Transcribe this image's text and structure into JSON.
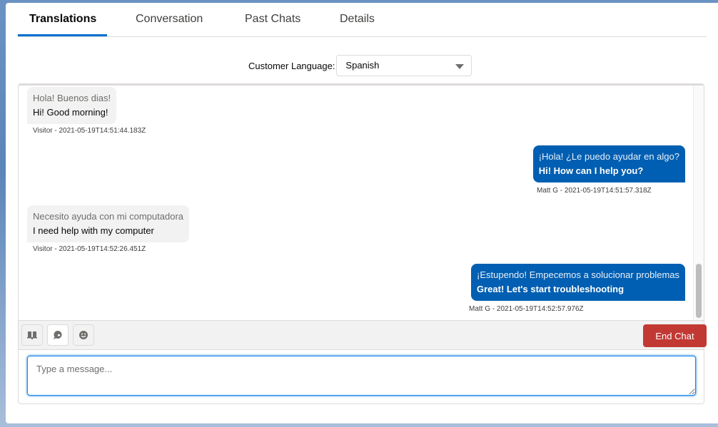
{
  "tabs": [
    {
      "label": "Translations",
      "active": true
    },
    {
      "label": "Conversation",
      "active": false
    },
    {
      "label": "Past Chats",
      "active": false
    },
    {
      "label": "Details",
      "active": false
    }
  ],
  "language": {
    "label": "Customer Language:",
    "selected": "Spanish"
  },
  "messages": [
    {
      "sender": "visitor",
      "original": "Hola! Buenos dias!",
      "translation": "Hi! Good morning!",
      "meta": "Visitor - 2021-05-19T14:51:44.183Z"
    },
    {
      "sender": "agent",
      "original": "¡Hola! ¿Le puedo ayudar en algo?",
      "translation": "Hi! How can I help you?",
      "meta": "Matt G - 2021-05-19T14:51:57.318Z"
    },
    {
      "sender": "visitor",
      "original": "Necesito ayuda con mi computadora",
      "translation": "I need help with my computer",
      "meta": "Visitor - 2021-05-19T14:52:26.451Z"
    },
    {
      "sender": "agent",
      "original": "¡Estupendo! Empecemos a solucionar problemas",
      "translation": "Great! Let's start troubleshooting",
      "meta": "Matt G - 2021-05-19T14:52:57.976Z"
    }
  ],
  "toolbar": {
    "icons": [
      "knowledge-book-icon",
      "chat-bubble-icon",
      "emoji-icon"
    ],
    "end_chat_label": "End Chat",
    "end_chat_color": "#c23934"
  },
  "composer": {
    "placeholder": "Type a message...",
    "value": ""
  },
  "colors": {
    "accent": "#0070d2",
    "agent_bubble": "#005fb2",
    "visitor_bubble": "#f2f2f2"
  }
}
